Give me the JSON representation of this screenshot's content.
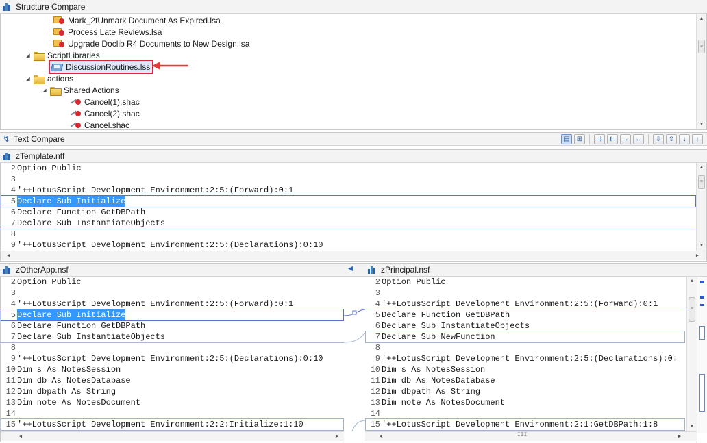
{
  "structure_compare": {
    "title": "Structure Compare",
    "tree": [
      {
        "label": "Mark_2fUnmark Document As Expired.lsa",
        "icon": "agent-icon"
      },
      {
        "label": "Process Late Reviews.lsa",
        "icon": "agent-icon"
      },
      {
        "label": "Upgrade Doclib R4 Documents to New Design.lsa",
        "icon": "agent-icon"
      },
      {
        "label": "ScriptLibraries",
        "icon": "folder-icon"
      },
      {
        "label": "DiscussionRoutines.lss",
        "icon": "script-library-icon"
      },
      {
        "label": "actions",
        "icon": "folder-icon"
      },
      {
        "label": "Shared Actions",
        "icon": "folder-icon"
      },
      {
        "label": "Cancel(1).shac",
        "icon": "shared-action-icon"
      },
      {
        "label": "Cancel(2).shac",
        "icon": "shared-action-icon"
      },
      {
        "label": "Cancel.shac",
        "icon": "shared-action-icon"
      }
    ]
  },
  "text_compare": {
    "title": "Text Compare",
    "toolbar_icons": [
      "two-pane-view-icon",
      "show-ancestor-icon",
      "copy-all-left-to-right-icon",
      "copy-all-right-to-left-icon",
      "copy-current-left-to-right-icon",
      "copy-current-right-to-left-icon",
      "next-difference-icon",
      "previous-difference-icon",
      "next-change-icon",
      "previous-change-icon"
    ]
  },
  "ancestor_pane": {
    "title": "zTemplate.ntf",
    "lines": [
      {
        "n": "2",
        "text": "Option Public"
      },
      {
        "n": "3",
        "text": ""
      },
      {
        "n": "4",
        "text": "'++LotusScript Development Environment:2:5:(Forward):0:1"
      },
      {
        "n": "5",
        "text": "Declare Sub Initialize"
      },
      {
        "n": "6",
        "text": "Declare Function GetDBPath"
      },
      {
        "n": "7",
        "text": "Declare Sub InstantiateObjects"
      },
      {
        "n": "8",
        "text": ""
      },
      {
        "n": "9",
        "text": "'++LotusScript Development Environment:2:5:(Declarations):0:10"
      }
    ]
  },
  "left_pane": {
    "title": "zOtherApp.nsf",
    "lines": [
      {
        "n": "2",
        "text": "Option Public"
      },
      {
        "n": "3",
        "text": ""
      },
      {
        "n": "4",
        "text": "'++LotusScript Development Environment:2:5:(Forward):0:1"
      },
      {
        "n": "5",
        "text": "Declare Sub Initialize"
      },
      {
        "n": "6",
        "text": "Declare Function GetDBPath"
      },
      {
        "n": "7",
        "text": "Declare Sub InstantiateObjects"
      },
      {
        "n": "8",
        "text": ""
      },
      {
        "n": "9",
        "text": "'++LotusScript Development Environment:2:5:(Declarations):0:10"
      },
      {
        "n": "10",
        "text": "Dim s As NotesSession"
      },
      {
        "n": "11",
        "text": "Dim db As NotesDatabase"
      },
      {
        "n": "12",
        "text": "Dim dbpath As String"
      },
      {
        "n": "13",
        "text": "Dim note As NotesDocument"
      },
      {
        "n": "14",
        "text": ""
      },
      {
        "n": "15",
        "text": "'++LotusScript Development Environment:2:2:Initialize:1:10"
      }
    ]
  },
  "right_pane": {
    "title": "zPrincipal.nsf",
    "lines": [
      {
        "n": "2",
        "text": "Option Public"
      },
      {
        "n": "3",
        "text": ""
      },
      {
        "n": "4",
        "text": "'++LotusScript Development Environment:2:5:(Forward):0:1"
      },
      {
        "n": "5",
        "text": "Declare Function GetDBPath"
      },
      {
        "n": "6",
        "text": "Declare Sub InstantiateObjects"
      },
      {
        "n": "7",
        "text": "Declare Sub NewFunction"
      },
      {
        "n": "8",
        "text": ""
      },
      {
        "n": "9",
        "text": "'++LotusScript Development Environment:2:5:(Declarations):0:"
      },
      {
        "n": "10",
        "text": "Dim s As NotesSession"
      },
      {
        "n": "11",
        "text": "Dim db As NotesDatabase"
      },
      {
        "n": "12",
        "text": "Dim dbpath As String"
      },
      {
        "n": "13",
        "text": "Dim note As NotesDocument"
      },
      {
        "n": "14",
        "text": ""
      },
      {
        "n": "15",
        "text": "'++LotusScript Development Environment:2:1:GetDBPath:1:8"
      }
    ]
  },
  "scrollbar_grip": "III",
  "colors": {
    "selection": "#3399ff",
    "highlight_border": "#d7263d",
    "arrow": "#e03a3a",
    "diff_rule": "#6b7fd0"
  }
}
